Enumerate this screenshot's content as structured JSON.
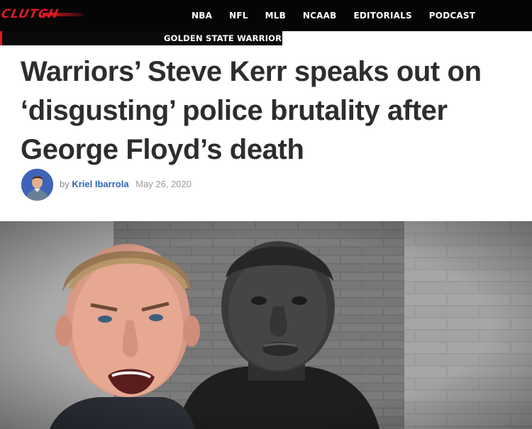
{
  "site": {
    "logo_text": "CLUTCH",
    "brand_color": "#e01a22"
  },
  "nav": {
    "items": [
      "NBA",
      "NFL",
      "MLB",
      "NCAAB",
      "EDITORIALS",
      "PODCAST"
    ]
  },
  "category": {
    "label": "GOLDEN STATE WARRIORS"
  },
  "article": {
    "headline_line1": "Warriors’ Steve Kerr speaks out on",
    "headline_line2": "‘disgusting’ police brutality after",
    "headline_line3": "George Floyd’s death",
    "byline_prefix": "by",
    "author": "Kriel Ibarrola",
    "date": "May 26, 2020"
  },
  "hero_image": {
    "subject": "photo-collage-portraits"
  }
}
